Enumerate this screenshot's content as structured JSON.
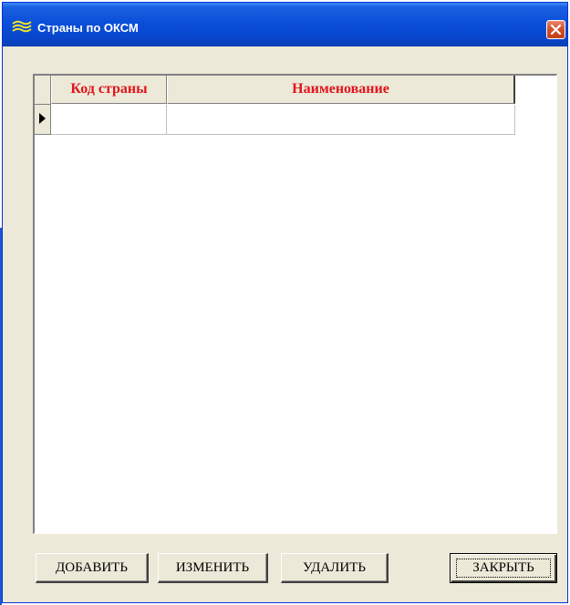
{
  "window": {
    "title": "Страны по ОКСМ",
    "icon": "oksm-app-icon",
    "close_icon": "close-icon",
    "accent_color": "#0a4fd9",
    "close_color": "#d6502c"
  },
  "grid": {
    "columns": [
      {
        "label": "Код страны"
      },
      {
        "label": "Наименование"
      }
    ],
    "header_color": "#e2141c",
    "rows": [
      {
        "code": "",
        "name": ""
      }
    ],
    "current_row_icon": "row-pointer-icon"
  },
  "buttons": {
    "add": "ДОБАВИТЬ",
    "edit": "ИЗМЕНИТЬ",
    "delete": "УДАЛИТЬ",
    "close": "ЗАКРЫТЬ"
  }
}
